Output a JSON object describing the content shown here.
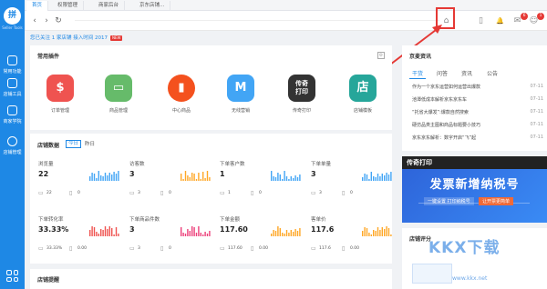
{
  "sidebar": {
    "logo": "拼",
    "logo_sub": "Seller Tools",
    "items": [
      {
        "label": "常用功能",
        "icon": "star-icon"
      },
      {
        "label": "店铺工具",
        "icon": "shop-icon"
      },
      {
        "label": "商家学院",
        "icon": "book-icon"
      },
      {
        "label": "店铺管理",
        "icon": "dashboard-icon"
      }
    ],
    "apps_icon": "grid-icon"
  },
  "tabs": [
    {
      "label": "首页",
      "active": true
    },
    {
      "label": "权限管理",
      "active": false
    },
    {
      "label": "商家后台",
      "active": false
    },
    {
      "label": "京东店铺...",
      "active": false
    }
  ],
  "toolbar": {
    "back": "‹",
    "forward": "›",
    "refresh": "↻",
    "icons": [
      {
        "name": "home-icon",
        "glyph": "⌂",
        "badge": ""
      },
      {
        "name": "mobile-icon",
        "glyph": "▯",
        "badge": ""
      },
      {
        "name": "bell-icon",
        "glyph": "🔔",
        "badge": ""
      },
      {
        "name": "message-icon",
        "glyph": "✉",
        "badge": "6"
      },
      {
        "name": "user-icon",
        "glyph": "☺",
        "badge": "1"
      }
    ]
  },
  "notice": {
    "text": "您已关注 1 家店铺 接入时间 2017",
    "badge": "NEW"
  },
  "plugins": {
    "title": "常用插件",
    "items": [
      {
        "label": "订单管理",
        "glyph": "$",
        "color": "#ef5350",
        "round": false
      },
      {
        "label": "商品管理",
        "glyph": "▭",
        "color": "#66bb6a",
        "round": false
      },
      {
        "label": "中心商品",
        "glyph": "▮",
        "color": "#f4511e",
        "round": true
      },
      {
        "label": "无线营销",
        "glyph": "M",
        "color": "#42a5f5",
        "round": false
      },
      {
        "label": "传奇打印",
        "glyph": "传奇\n打印",
        "color": "#333333",
        "round": false
      },
      {
        "label": "店铺模板",
        "glyph": "店",
        "color": "#26a69a",
        "round": false
      }
    ]
  },
  "stats": {
    "title": "店铺数据",
    "tabs": [
      {
        "label": "今日",
        "active": true
      },
      {
        "label": "昨日",
        "active": false
      }
    ],
    "items": [
      {
        "name": "浏览量",
        "value": "22",
        "color": "#42a5f5",
        "pc": "22",
        "mobile": "0"
      },
      {
        "name": "访客数",
        "value": "3",
        "color": "#ffa726",
        "pc": "3",
        "mobile": "0"
      },
      {
        "name": "下单客户数",
        "value": "1",
        "color": "#42a5f5",
        "pc": "1",
        "mobile": "0"
      },
      {
        "name": "下单单量",
        "value": "3",
        "color": "#42a5f5",
        "pc": "3",
        "mobile": "0"
      },
      {
        "name": "下单转化率",
        "value": "33.33%",
        "color": "#ef5350",
        "pc": "33.33%",
        "mobile": "0.00"
      },
      {
        "name": "下单商品件数",
        "value": "3",
        "color": "#ec407a",
        "pc": "3",
        "mobile": "0"
      },
      {
        "name": "下单金额",
        "value": "117.60",
        "color": "#ffa726",
        "pc": "117.60",
        "mobile": "0.00"
      },
      {
        "name": "客单价",
        "value": "117.6",
        "color": "#ffa726",
        "pc": "117.6",
        "mobile": "0.00"
      }
    ]
  },
  "reminder": {
    "title": "店铺提醒"
  },
  "news": {
    "title": "京麦资讯",
    "tabs": [
      {
        "label": "干货",
        "active": true
      },
      {
        "label": "问答",
        "active": false
      },
      {
        "label": "资讯",
        "active": false
      },
      {
        "label": "公告",
        "active": false
      }
    ],
    "items": [
      {
        "title": "作为一个京东运营如何运营出爆款",
        "date": "07-11"
      },
      {
        "title": "池潭低成本解析京东京东车",
        "date": "07-11"
      },
      {
        "title": "“托省大爆发”:爆款自然搜索",
        "date": "07-11"
      },
      {
        "title": "硬仿品类主图和商品标题要小技巧",
        "date": "07-11"
      },
      {
        "title": "京东京东解析：数字开启“飞”起",
        "date": "07-11"
      }
    ]
  },
  "banner": {
    "chip": "传奇打印",
    "main": "发票新增纳税号",
    "sub_a": "一键设置 打印纳税号",
    "sub_b": "让开票更简单"
  },
  "rating": {
    "title": "店铺评分"
  },
  "watermark": {
    "main": "KKX下载",
    "sub": "www.kkx.net"
  }
}
